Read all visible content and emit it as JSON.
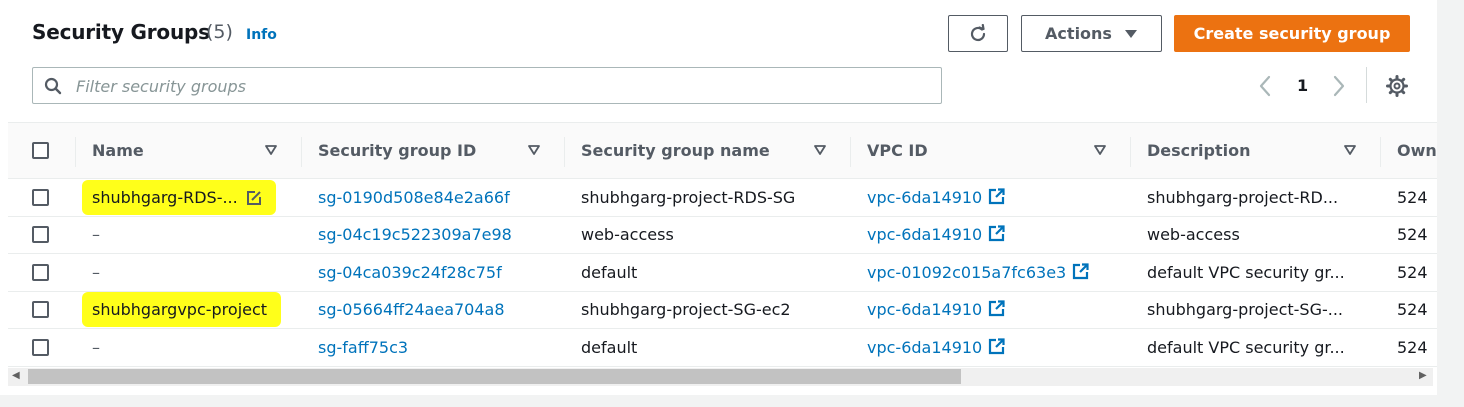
{
  "header": {
    "title": "Security Groups",
    "count": "(5)",
    "info": "Info"
  },
  "toolbar": {
    "actions_label": "Actions",
    "create_label": "Create security group"
  },
  "search": {
    "placeholder": "Filter security groups"
  },
  "pagination": {
    "current_page": "1"
  },
  "table": {
    "columns": [
      "Name",
      "Security group ID",
      "Security group name",
      "VPC ID",
      "Description",
      "Own"
    ],
    "rows": [
      {
        "name": "shubhgarg-RDS-...",
        "sg_id": "sg-0190d508e84e2a66f",
        "sg_name": "shubhgarg-project-RDS-SG",
        "vpc": "vpc-6da14910",
        "description": "shubhgarg-project-RD...",
        "owner": "524"
      },
      {
        "name": "–",
        "sg_id": "sg-04c19c522309a7e98",
        "sg_name": "web-access",
        "vpc": "vpc-6da14910",
        "description": "web-access",
        "owner": "524"
      },
      {
        "name": "–",
        "sg_id": "sg-04ca039c24f28c75f",
        "sg_name": "default",
        "vpc": "vpc-01092c015a7fc63e3",
        "description": "default VPC security gr...",
        "owner": "524"
      },
      {
        "name": "shubhgargvpc-project",
        "sg_id": "sg-05664ff24aea704a8",
        "sg_name": "shubhgarg-project-SG-ec2",
        "vpc": "vpc-6da14910",
        "description": "shubhgarg-project-SG-...",
        "owner": "524"
      },
      {
        "name": "–",
        "sg_id": "sg-faff75c3",
        "sg_name": "default",
        "vpc": "vpc-6da14910",
        "description": "default VPC security gr...",
        "owner": "524"
      }
    ]
  },
  "icons": {
    "refresh": "refresh-icon",
    "dropdown": "caret-down-icon",
    "search": "search-icon",
    "prev": "chevron-left-icon",
    "next": "chevron-right-icon",
    "settings": "gear-icon",
    "sort": "sort-caret-icon",
    "external": "external-link-icon",
    "edit": "edit-icon"
  },
  "colors": {
    "primary": "#ec7211",
    "link": "#0073bb",
    "highlight": "#ffff1a"
  }
}
